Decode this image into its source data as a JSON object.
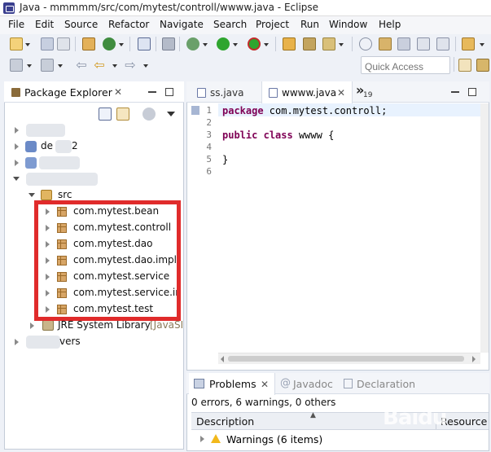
{
  "window": {
    "title": "Java - mmmmm/src/com/mytest/controll/wwww.java - Eclipse"
  },
  "menu": [
    "File",
    "Edit",
    "Source",
    "Refactor",
    "Navigate",
    "Search",
    "Project",
    "Run",
    "Window",
    "Help"
  ],
  "toolbar": {
    "quick_access_placeholder": "Quick Access",
    "icons": [
      "new-icon",
      "save-icon",
      "print-icon",
      "build-icon",
      "refresh-icon",
      "console-icon",
      "debug-icon",
      "run-icon",
      "run-external-icon",
      "open-type-icon",
      "search-icon",
      "annotation-icon",
      "perspective-icon"
    ]
  },
  "package_explorer": {
    "tab_label": "Package Explorer",
    "tree": {
      "partial_label_2": "de",
      "partial_label_2_suffix": "2",
      "src": "src",
      "packages": [
        "com.mytest.bean",
        "com.mytest.controll",
        "com.mytest.dao",
        "com.mytest.dao.impl",
        "com.mytest.service",
        "com.mytest.service.im",
        "com.mytest.test"
      ],
      "jre_library": "JRE System Library",
      "jre_suffix": "[JavaSE",
      "partial_label_last": "vers"
    },
    "highlight_color": "#e02b2b"
  },
  "editor": {
    "tabs": [
      {
        "label": "ss.java",
        "active": false
      },
      {
        "label": "wwww.java",
        "active": true
      }
    ],
    "overflow_indicator": "»",
    "overflow_count": "19",
    "line_numbers": [
      "1",
      "2",
      "3",
      "4",
      "5",
      "6"
    ],
    "code": {
      "line1_kw": "package",
      "line1_rest": " com.mytest.controll;",
      "line3_kw1": "public",
      "line3_kw2": "class",
      "line3_rest": " wwww {",
      "line5": "}"
    },
    "keyword_color": "#7f0055"
  },
  "problems": {
    "tabs": [
      "Problems",
      "Javadoc",
      "Declaration"
    ],
    "summary": "0 errors, 6 warnings, 0 others",
    "columns": [
      "Description",
      "Resource"
    ],
    "rows": [
      {
        "label": "Warnings (6 items)"
      }
    ],
    "warning_color": "#f2b81b"
  },
  "watermark": "Baidu"
}
